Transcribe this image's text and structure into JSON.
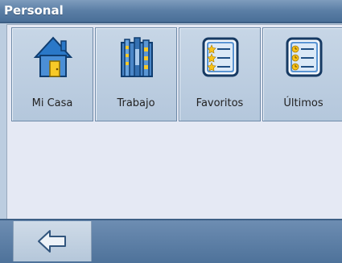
{
  "header": {
    "title": "Personal"
  },
  "tiles": [
    {
      "label": "Mi Casa",
      "icon": "house-icon"
    },
    {
      "label": "Trabajo",
      "icon": "office-building-icon"
    },
    {
      "label": "Favoritos",
      "icon": "starred-list-icon"
    },
    {
      "label": "Últimos",
      "icon": "recent-list-icon"
    }
  ],
  "footer": {
    "back_icon": "back-arrow-icon"
  },
  "colors": {
    "titlebar": "#5a7ea5",
    "panel": "#e5e9f4",
    "tile": "#bccde0",
    "background": "#bccde0"
  }
}
